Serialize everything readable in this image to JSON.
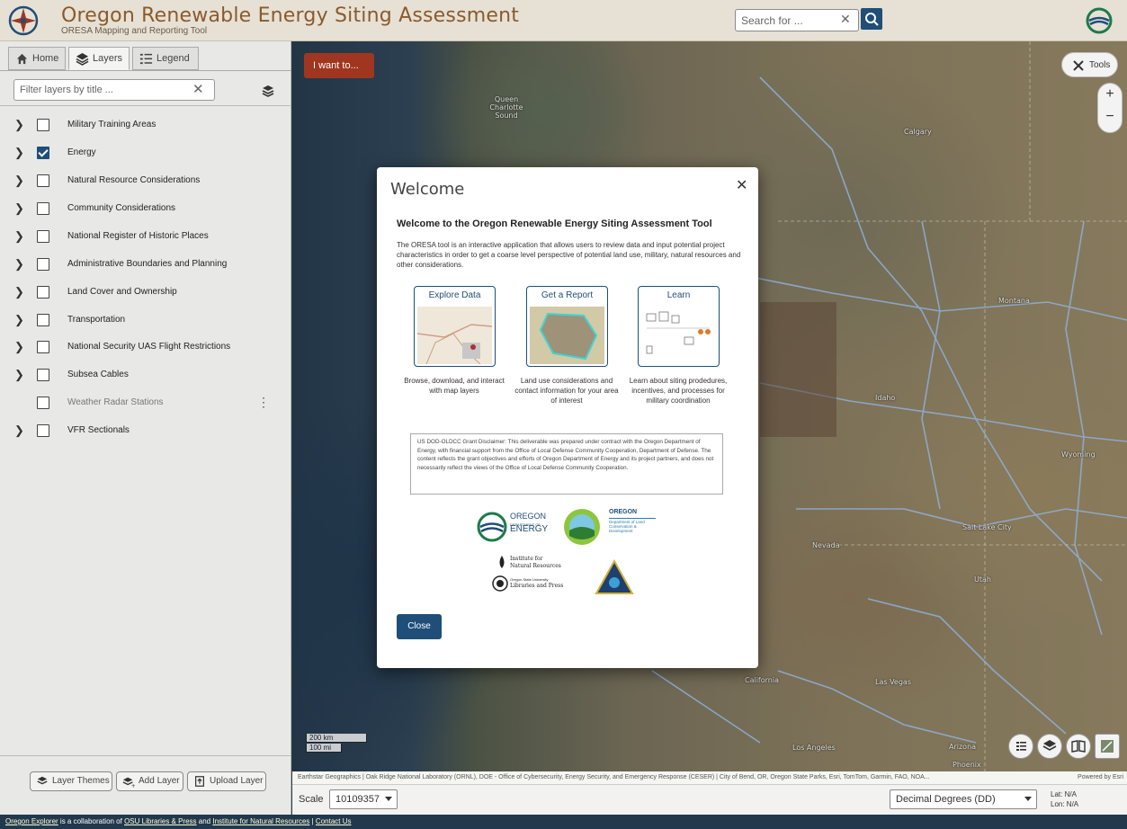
{
  "header": {
    "title": "Oregon Renewable Energy Siting Assessment",
    "subtitle": "ORESA Mapping and Reporting Tool",
    "search_placeholder": "Search for ..."
  },
  "tabs": [
    {
      "label": "Home",
      "icon": "home-icon"
    },
    {
      "label": "Layers",
      "icon": "layers-icon",
      "active": true
    },
    {
      "label": "Legend",
      "icon": "legend-icon"
    }
  ],
  "filter_placeholder": "Filter layers by title ...",
  "layers": [
    {
      "label": "Military Training Areas",
      "checked": false,
      "expandable": true
    },
    {
      "label": "Energy",
      "checked": true,
      "expandable": true
    },
    {
      "label": "Natural Resource Considerations",
      "checked": false,
      "expandable": true
    },
    {
      "label": "Community Considerations",
      "checked": false,
      "expandable": true
    },
    {
      "label": "National Register of Historic Places",
      "checked": false,
      "expandable": true
    },
    {
      "label": "Administrative Boundaries and Planning",
      "checked": false,
      "expandable": true
    },
    {
      "label": "Land Cover and Ownership",
      "checked": false,
      "expandable": true
    },
    {
      "label": "Transportation",
      "checked": false,
      "expandable": true
    },
    {
      "label": "National Security UAS Flight Restrictions",
      "checked": false,
      "expandable": true
    },
    {
      "label": "Subsea Cables",
      "checked": false,
      "expandable": true
    },
    {
      "label": "Weather Radar Stations",
      "checked": false,
      "expandable": false
    },
    {
      "label": "VFR Sectionals",
      "checked": false,
      "expandable": true
    }
  ],
  "panel_buttons": {
    "layer_themes": "Layer Themes",
    "add_layer": "Add Layer",
    "upload_layer": "Upload Layer"
  },
  "map": {
    "i_want_to": "I want to...",
    "tools": "Tools",
    "zoom_in": "+",
    "zoom_out": "−",
    "scalebar_km": "200 km",
    "scalebar_mi": "100 mi",
    "labels": {
      "queen_charlotte": "Queen Charlotte Sound",
      "calgary": "Calgary",
      "montana": "Montana",
      "idaho": "Idaho",
      "wyoming": "Wyoming",
      "salt_lake": "Salt Lake City",
      "nevada": "Nevada",
      "utah": "Utah",
      "california": "California",
      "las_vegas": "Las Vegas",
      "los_angeles": "Los Angeles",
      "arizona": "Arizona",
      "phoenix": "Phoenix"
    },
    "attribution": "Earthstar Geographics | Oak Ridge National Laboratory (ORNL), DOE - Office of Cybersecurity, Energy Security, and Emergency Response (CESER) | City of Bend, OR, Oregon State Parks, Esri, TomTom, Garmin, FAO, NOA...",
    "powered_by": "Powered by Esri"
  },
  "bottom_bar": {
    "scale_label": "Scale",
    "scale_value": "10109357",
    "coord_system": "Decimal Degrees (DD)",
    "lat": "Lat: N/A",
    "lon": "Lon: N/A"
  },
  "footer": {
    "explorer": "Oregon Explorer",
    "text1": " is a collaboration of ",
    "osu": "OSU Libraries & Press",
    "text2": " and ",
    "inr": "Institute for Natural Resources",
    "sep": " | ",
    "contact": "Contact Us"
  },
  "modal": {
    "title": "Welcome",
    "heading": "Welcome to the Oregon Renewable Energy Siting Assessment Tool",
    "intro": "The ORESA tool is an interactive application that allows users to review data and input potential project characteristics in order to get a coarse level perspective of potential land use, military, natural resources and other considerations.",
    "cards": [
      {
        "title": "Explore Data",
        "desc": "Browse, download, and interact with map layers"
      },
      {
        "title": "Get a Report",
        "desc": "Land use considerations and contact information for your area of interest"
      },
      {
        "title": "Learn",
        "desc": "Learn about siting prodedures, incentives, and processes for military coordination"
      }
    ],
    "disclaimer": "US DOD-OLDCC Grant Disclaimer: This deliverable was prepared under contract with the Oregon Department of Energy, with financial support from the Office of Local Defense Community Cooperation, Department of Defense. The content reflects the grant objectives and efforts of Oregon Department of Energy and its project partners, and does not necessarily reflect the views of the Office of Local Defense Community Cooperation.",
    "partners": {
      "odoe_1": "OREGON",
      "odoe_2": "DEPARTMENT OF",
      "odoe_3": "ENERGY",
      "dlcd_1": "OREGON",
      "dlcd_2": "Department of Land Conservation & Development",
      "inr_1": "Institute for",
      "inr_2": "Natural Resources",
      "osu_1": "Oregon State University",
      "osu_2": "Libraries and Press"
    },
    "close_label": "Close"
  },
  "colors": {
    "accent": "#1f4e79",
    "header_title": "#8a5a2c",
    "i_want_to": "#a0361f"
  }
}
